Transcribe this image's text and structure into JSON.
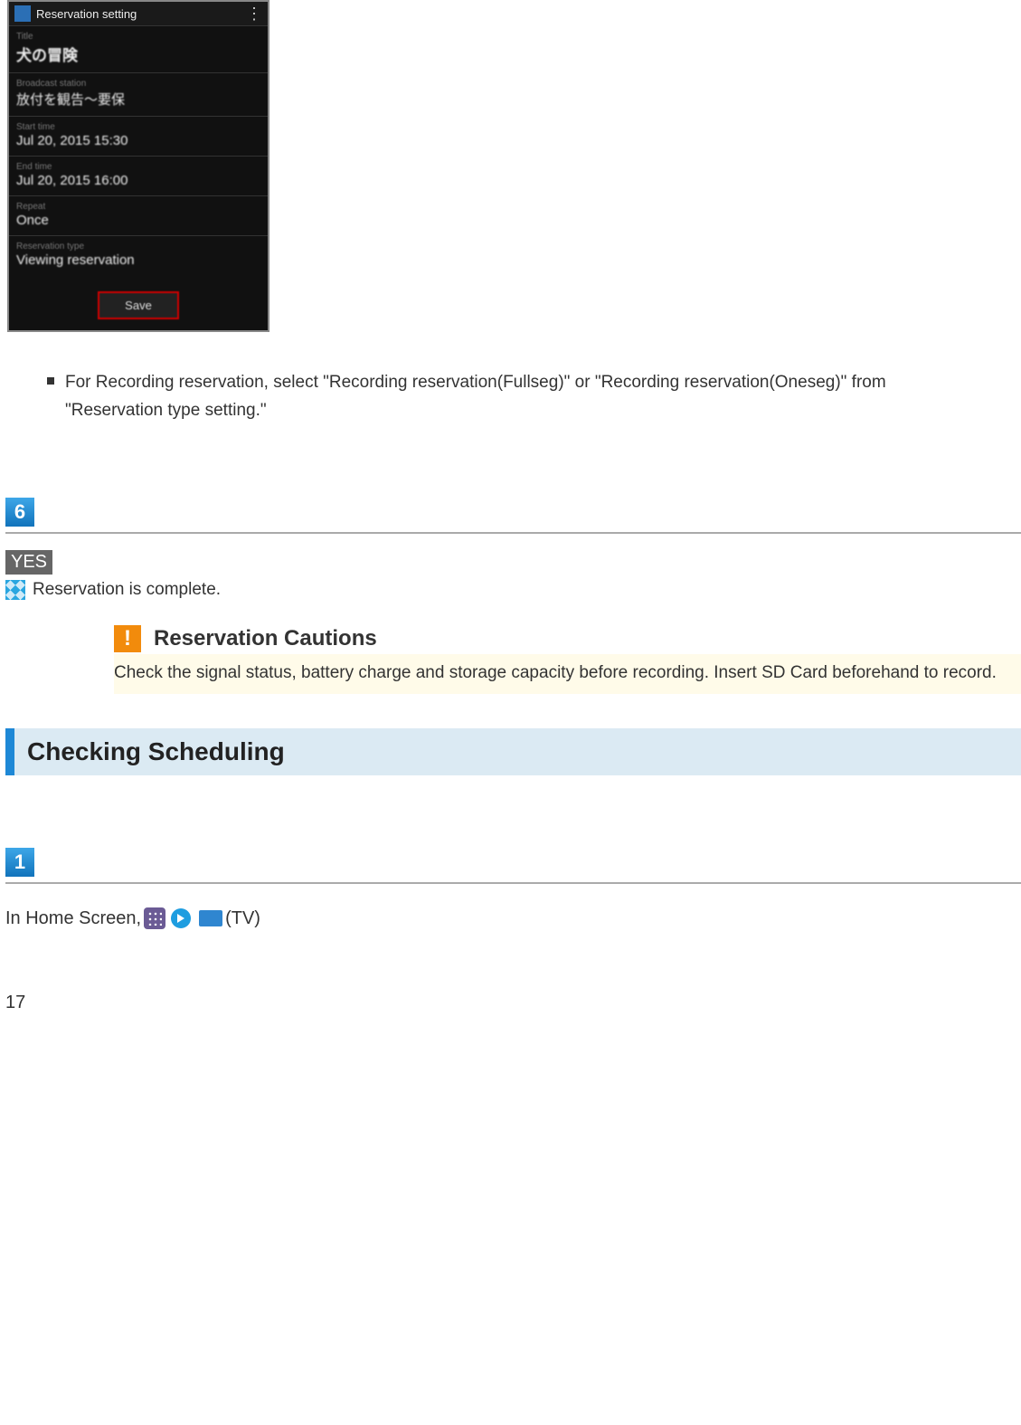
{
  "screenshot": {
    "header": "Reservation setting",
    "fields": {
      "title_label": "Title",
      "title_value": "犬の冒険",
      "channel_label": "Broadcast station",
      "channel_value": "放付を観告～要保",
      "start_label": "Start time",
      "start_value": "Jul 20, 2015 15:30",
      "end_label": "End time",
      "end_value": "Jul 20, 2015 16:00",
      "repeat_label": "Repeat",
      "repeat_value": "Once",
      "type_label": "Reservation type",
      "type_value": "Viewing reservation"
    },
    "save_button": "Save"
  },
  "note_bullet": "For Recording reservation, select \"Recording reservation(Fullseg)\" or \"Recording reservation(Oneseg)\" from \"Reservation type setting.\"",
  "step6_number": "6",
  "yes_label": "YES",
  "complete_text": "Reservation is complete.",
  "caution": {
    "title": "Reservation Cautions",
    "body": "Check the signal status, battery charge and storage capacity before recording. Insert SD Card beforehand to record."
  },
  "section_title": "Checking Scheduling",
  "step1_number": "1",
  "step1_text_prefix": "In Home Screen, ",
  "step1_text_suffix": " (TV)",
  "page_number": "17"
}
